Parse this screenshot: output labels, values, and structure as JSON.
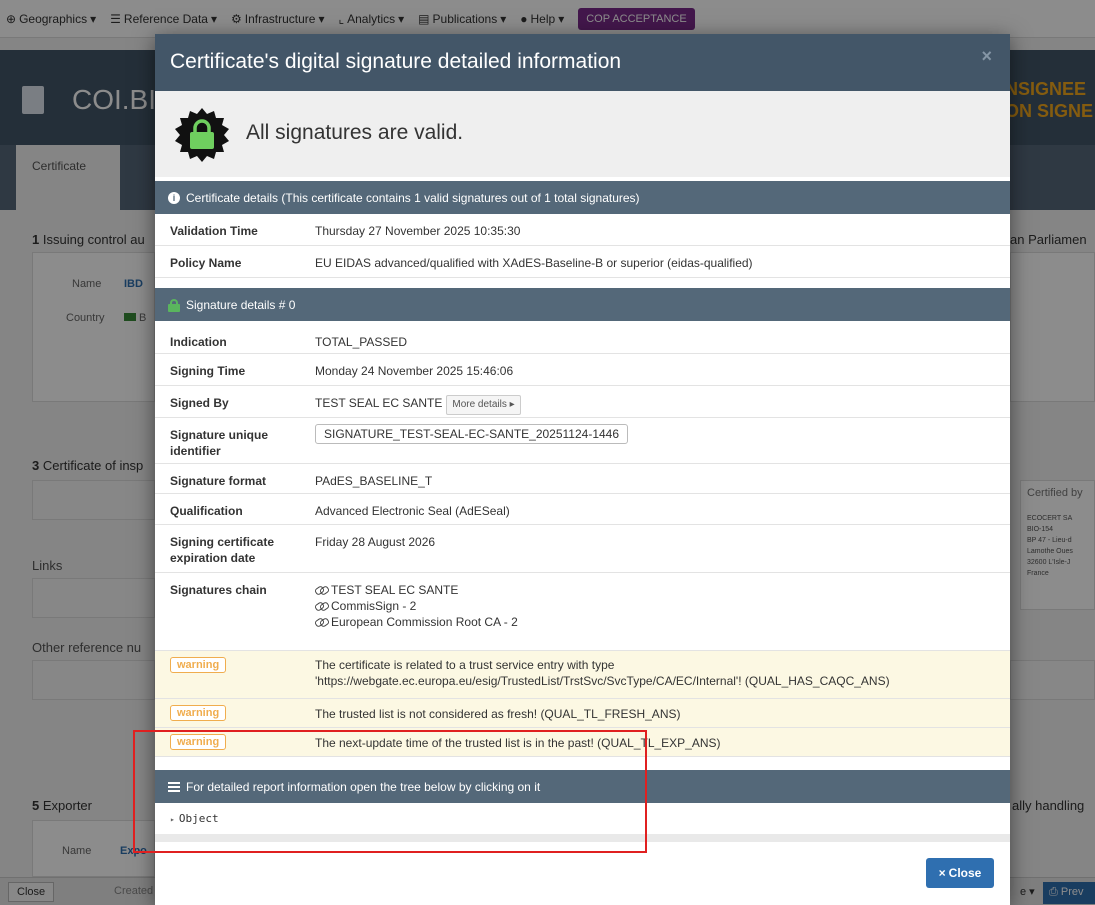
{
  "app": {
    "nav": [
      {
        "icon": "globe-icon",
        "label": "Geographics"
      },
      {
        "icon": "database-icon",
        "label": "Reference Data"
      },
      {
        "icon": "gear-icon",
        "label": "Infrastructure"
      },
      {
        "icon": "chart-icon",
        "label": "Analytics"
      },
      {
        "icon": "book-icon",
        "label": "Publications"
      },
      {
        "icon": "help-icon",
        "label": "Help"
      }
    ],
    "env_badge": "COP ACCEPTANCE",
    "doc_title": "COI.BI",
    "right_title_1": "NSIGNEE",
    "right_title_2": "ON SIGNE",
    "tab_certificate": "Certificate",
    "issuing_label_num": "1",
    "issuing_label": "Issuing control au",
    "name_label": "Name",
    "name_value": "IBD",
    "country_label": "Country",
    "country_value": "B",
    "parliament": "an Parliamen",
    "cert_insp_num": "3",
    "cert_insp": "Certificate of insp",
    "certified_by": "Certified by",
    "certified_addr": [
      "ECOCERT SA",
      "BIO-154",
      "BP 47 - Lieu-d",
      "Lamothe Oues",
      "32600 L'Isle-J",
      "France"
    ],
    "links": "Links",
    "other_ref": "Other reference nu",
    "exporter_num": "5",
    "exporter": "Exporter",
    "handling": "ally handling",
    "exporter_name_label": "Name",
    "exporter_name_value": "Expo",
    "footer_close": "Close",
    "footer_created": "Created",
    "footer_caret": "e",
    "footer_preview": "Prev"
  },
  "modal": {
    "title": "Certificate's digital signature detailed information",
    "close_x": "×",
    "valid_text": "All signatures are valid.",
    "cert_details_head": "Certificate details (This certificate contains 1 valid signatures out of 1 total signatures)",
    "cert_rows": [
      {
        "key": "Validation Time",
        "value": "Thursday 27 November 2025 10:35:30"
      },
      {
        "key": "Policy Name",
        "value": "EU EIDAS advanced/qualified with XAdES-Baseline-B or superior (eidas-qualified)"
      }
    ],
    "sig_details_head": "Signature details # 0",
    "sig_rows": {
      "indication": {
        "key": "Indication",
        "value": "TOTAL_PASSED"
      },
      "signing_time": {
        "key": "Signing Time",
        "value": "Monday 24 November 2025 15:46:06"
      },
      "signed_by": {
        "key": "Signed By",
        "value": "TEST SEAL EC SANTE",
        "more": "More details ▸"
      },
      "unique_id": {
        "key": "Signature unique identifier",
        "value": "SIGNATURE_TEST-SEAL-EC-SANTE_20251124-1446"
      },
      "format": {
        "key": "Signature format",
        "value": "PAdES_BASELINE_T"
      },
      "qualification": {
        "key": "Qualification",
        "value": "Advanced Electronic Seal (AdESeal)"
      },
      "expiration": {
        "key": "Signing certificate expiration date",
        "value": "Friday 28 August 2026"
      },
      "chain": {
        "key": "Signatures chain",
        "items": [
          "TEST SEAL EC SANTE",
          "CommisSign - 2",
          "European Commission Root CA - 2"
        ]
      }
    },
    "warnings": [
      {
        "tag": "warning",
        "line1": "The certificate is related to a trust service entry with type",
        "line2": "'https://webgate.ec.europa.eu/esig/TrustedList/TrstSvc/SvcType/CA/EC/Internal'! (QUAL_HAS_CAQC_ANS)"
      },
      {
        "tag": "warning",
        "line1": "The trusted list is not considered as fresh! (QUAL_TL_FRESH_ANS)",
        "line2": ""
      },
      {
        "tag": "warning",
        "line1": "The next-update time of the trusted list is in the past! (QUAL_TL_EXP_ANS)",
        "line2": ""
      }
    ],
    "report_head": "For detailed report information open the tree below by clicking on it",
    "object_label": "Object",
    "close_label": "Close",
    "colors": {
      "header": "#435668",
      "section": "#546879",
      "warning": "#f0ad4e",
      "primary": "#2f6fb0",
      "valid_green": "#5ab55e",
      "highlight": "#e02020"
    }
  }
}
